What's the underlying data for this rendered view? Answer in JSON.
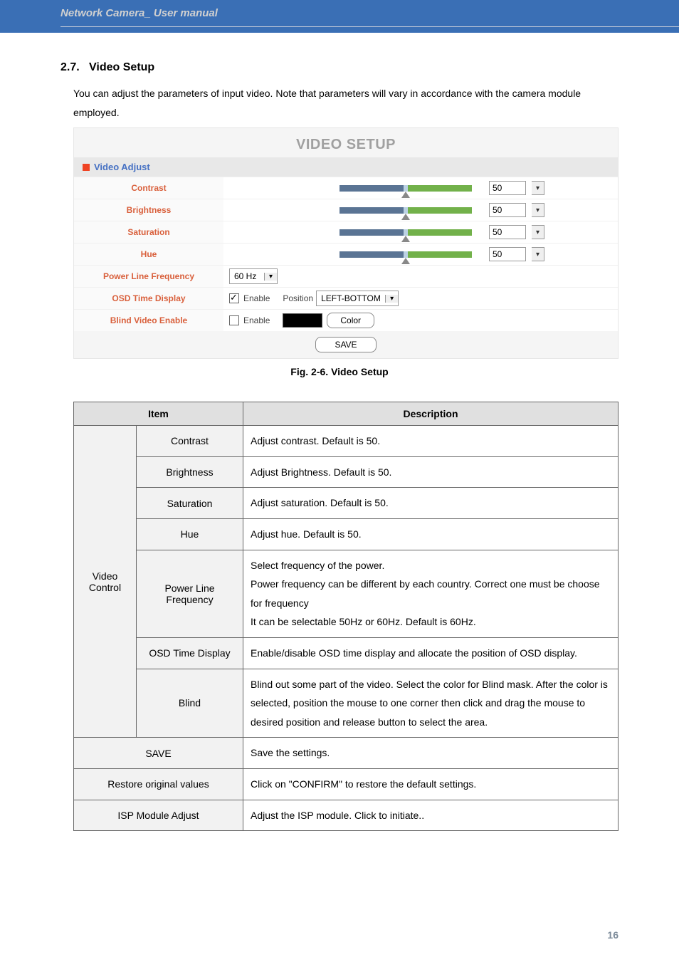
{
  "header": {
    "title": "Network Camera_ User manual"
  },
  "section": {
    "number": "2.7.",
    "title": "Video Setup",
    "intro": "You can adjust the parameters of input video. Note that parameters will vary in accordance with the camera module employed."
  },
  "panel": {
    "title": "VIDEO SETUP",
    "section_label": "Video Adjust",
    "rows": {
      "contrast": {
        "label": "Contrast",
        "value": "50"
      },
      "brightness": {
        "label": "Brightness",
        "value": "50"
      },
      "saturation": {
        "label": "Saturation",
        "value": "50"
      },
      "hue": {
        "label": "Hue",
        "value": "50"
      },
      "plf": {
        "label": "Power Line Frequency",
        "value": "60 Hz"
      },
      "osd": {
        "label": "OSD Time Display",
        "enable_label": "Enable",
        "position_label": "Position",
        "position_value": "LEFT-BOTTOM"
      },
      "blind": {
        "label": "Blind Video Enable",
        "enable_label": "Enable",
        "color_button": "Color"
      }
    },
    "save_button": "SAVE"
  },
  "fig_caption": "Fig. 2-6. Video Setup",
  "table": {
    "headers": {
      "item": "Item",
      "desc": "Description"
    },
    "group_label": "Video Control",
    "rows": {
      "contrast": {
        "item": "Contrast",
        "desc": "Adjust contrast. Default is 50."
      },
      "brightness": {
        "item": "Brightness",
        "desc": "Adjust Brightness. Default is 50."
      },
      "saturation": {
        "item": "Saturation",
        "desc": "Adjust saturation. Default is 50."
      },
      "hue": {
        "item": "Hue",
        "desc": "Adjust hue. Default is 50."
      },
      "plf": {
        "item": "Power Line Frequency",
        "desc": "Select frequency of the power.\nPower frequency can be different by each country. Correct one must be choose for frequency\nIt can be selectable 50Hz or 60Hz. Default is 60Hz."
      },
      "osd": {
        "item": "OSD Time Display",
        "desc": "Enable/disable OSD time display and allocate the position of OSD display."
      },
      "blind": {
        "item": "Blind",
        "desc": "Blind out some part of the video. Select the color for Blind mask. After the color is selected, position the mouse to one corner then click and drag the mouse to desired position and release button to select the area."
      },
      "save": {
        "item": "SAVE",
        "desc": "Save the settings."
      },
      "restore": {
        "item": "Restore original values",
        "desc": "Click on \"CONFIRM\" to restore the default settings."
      },
      "isp": {
        "item": "ISP Module Adjust",
        "desc": "Adjust the ISP module. Click to initiate.."
      }
    }
  },
  "page_number": "16"
}
